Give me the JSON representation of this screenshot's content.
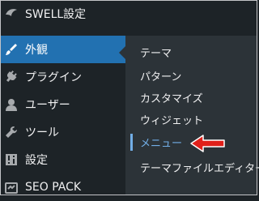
{
  "menu": {
    "items": [
      {
        "label": "SWELL設定",
        "icon": "swell-icon"
      },
      {
        "label": "外観",
        "icon": "paintbrush-icon"
      },
      {
        "label": "プラグイン",
        "icon": "plug-icon"
      },
      {
        "label": "ユーザー",
        "icon": "user-icon"
      },
      {
        "label": "ツール",
        "icon": "wrench-icon"
      },
      {
        "label": "設定",
        "icon": "settings-icon"
      },
      {
        "label": "SEO PACK",
        "icon": "seo-pack-icon"
      }
    ]
  },
  "submenu": {
    "items": [
      {
        "label": "テーマ"
      },
      {
        "label": "パターン"
      },
      {
        "label": "カスタマイズ"
      },
      {
        "label": "ウィジェット"
      },
      {
        "label": "メニュー"
      },
      {
        "label": "テーマファイルエディター"
      }
    ]
  },
  "colors": {
    "sidebar_bg": "#1d2327",
    "active_bg": "#2271b1",
    "submenu_bg": "#2c3338",
    "highlight": "#72aee6",
    "annotation_arrow": "#e0201a"
  }
}
